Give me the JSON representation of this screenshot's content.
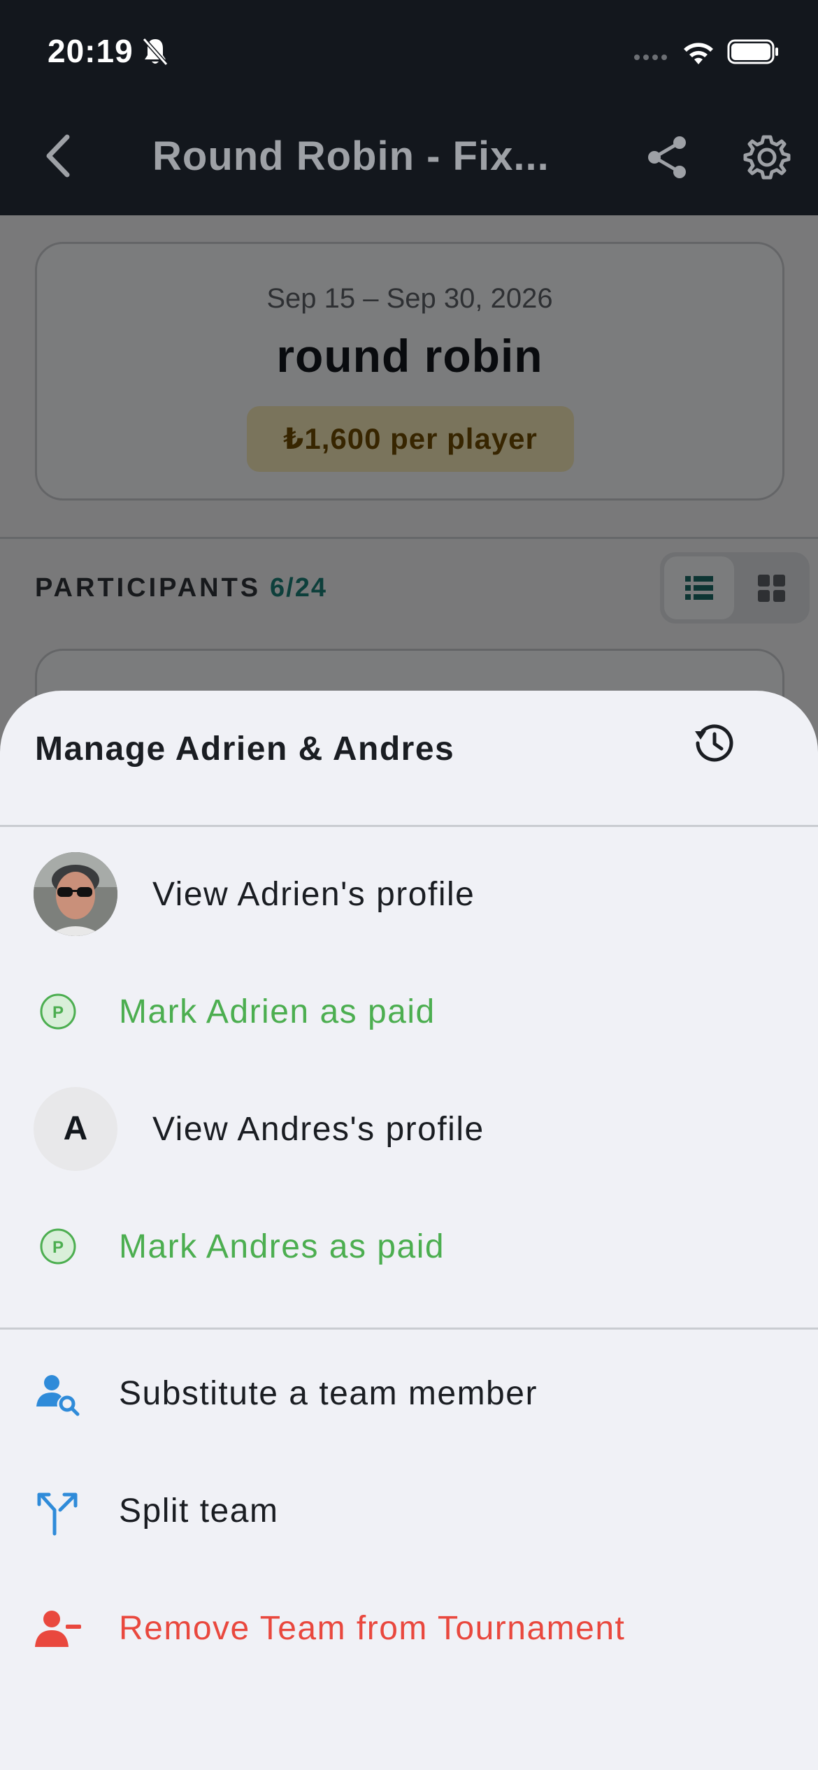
{
  "status_bar": {
    "time": "20:19"
  },
  "nav": {
    "title": "Round Robin - Fix..."
  },
  "event": {
    "dates": "Sep 15 – Sep 30, 2026",
    "name": "round robin",
    "price": "₺1,600 per player"
  },
  "participants": {
    "label": "PARTICIPANTS",
    "count": "6/24"
  },
  "sheet": {
    "title": "Manage Adrien & Andres",
    "items": {
      "view_adrien": "View Adrien's profile",
      "mark_adrien": "Mark Adrien as paid",
      "andres_initial": "A",
      "view_andres": "View Andres's profile",
      "mark_andres": "Mark Andres as paid",
      "substitute": "Substitute a team member",
      "split": "Split team",
      "remove": "Remove Team from Tournament"
    }
  },
  "colors": {
    "accent_teal": "#1b7f77",
    "paid_green": "#4cae50",
    "action_blue": "#2f8bd9",
    "danger_red": "#e9483e",
    "price_badge": "#f5e9b8"
  },
  "icons": [
    "bell-slash-icon",
    "signal-icon",
    "wifi-icon",
    "battery-icon",
    "back-chevron-icon",
    "share-icon",
    "gear-icon",
    "list-view-icon",
    "grid-view-icon",
    "history-icon",
    "paid-p-icon",
    "person-search-icon",
    "split-arrows-icon",
    "person-remove-icon"
  ]
}
